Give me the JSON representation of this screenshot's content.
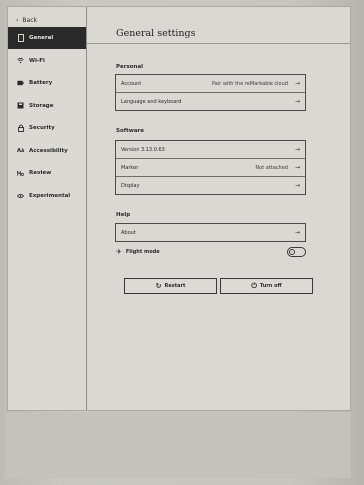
{
  "sidebar": {
    "back_label": "Back",
    "items": [
      {
        "label": "General",
        "icon": "tablet-icon",
        "active": true
      },
      {
        "label": "Wi-Fi",
        "icon": "wifi-icon"
      },
      {
        "label": "Battery",
        "icon": "battery-icon"
      },
      {
        "label": "Storage",
        "icon": "storage-icon"
      },
      {
        "label": "Security",
        "icon": "lock-icon"
      },
      {
        "label": "Accessibility",
        "icon": "accessibility-icon"
      },
      {
        "label": "Review",
        "icon": "review-icon"
      },
      {
        "label": "Experimental",
        "icon": "eye-icon"
      }
    ]
  },
  "main": {
    "title": "General settings",
    "personal": {
      "title": "Personal",
      "rows": [
        {
          "label": "Account",
          "value": "Pair with the reMarkable cloud"
        },
        {
          "label": "Language and keyboard",
          "value": ""
        }
      ]
    },
    "software": {
      "title": "Software",
      "rows": [
        {
          "label": "Version 3.13.0.63",
          "value": ""
        },
        {
          "label": "Marker",
          "value": "Not attached"
        },
        {
          "label": "Display",
          "value": ""
        }
      ]
    },
    "help": {
      "title": "Help",
      "rows": [
        {
          "label": "About",
          "value": ""
        }
      ]
    },
    "flight_mode": {
      "label": "Flight mode",
      "enabled": false
    },
    "restart_label": "Restart",
    "turn_off_label": "Turn off",
    "arrow": "→"
  }
}
